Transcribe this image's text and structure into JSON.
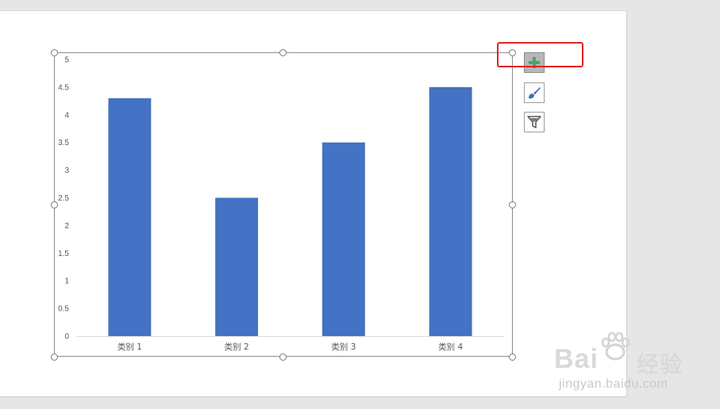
{
  "chart_data": {
    "type": "bar",
    "categories": [
      "类别 1",
      "类别 2",
      "类别 3",
      "类别 4"
    ],
    "values": [
      4.3,
      2.5,
      3.5,
      4.5
    ],
    "ylim": [
      0,
      5
    ],
    "yticks": [
      "0",
      "0.5",
      "1",
      "1.5",
      "2",
      "2.5",
      "3",
      "3.5",
      "4",
      "4.5",
      "5"
    ],
    "bar_color": "#4472c4",
    "grid": false,
    "legend": "none"
  },
  "side_buttons": [
    {
      "name": "chart-elements-button",
      "icon": "plus-icon",
      "active": true
    },
    {
      "name": "chart-styles-button",
      "icon": "paintbrush-icon",
      "active": false
    },
    {
      "name": "chart-filters-button",
      "icon": "funnel-icon",
      "active": false
    }
  ],
  "colors": {
    "accent_plus": "#3fa96a",
    "highlight": "#e0231f",
    "brush": "#3b6fb6"
  },
  "watermark": {
    "brand": "Bai",
    "brand_cn": "经验",
    "url": "jingyan.baidu.com"
  }
}
